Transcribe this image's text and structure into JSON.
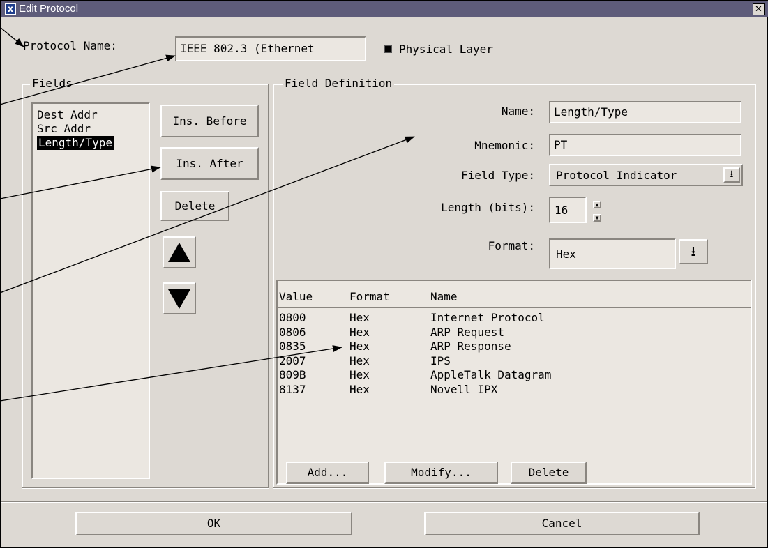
{
  "window": {
    "title": "Edit Protocol",
    "app_icon": "x-icon",
    "close_icon": "close-icon"
  },
  "protocol": {
    "name_label": "Protocol Name:",
    "name_value": "IEEE 802.3 (Ethernet",
    "physical_layer_label": "Physical Layer",
    "physical_layer_checked": true
  },
  "fields": {
    "group_label": "Fields",
    "items": [
      "Dest Addr",
      "Src  Addr",
      "Length/Type"
    ],
    "selected_index": 2,
    "buttons": {
      "ins_before": "Ins. Before",
      "ins_after": "Ins. After",
      "delete": "Delete",
      "move_up_icon": "up-triangle-icon",
      "move_down_icon": "down-triangle-icon"
    }
  },
  "field_definition": {
    "group_label": "Field Definition",
    "name_label": "Name:",
    "name_value": "Length/Type",
    "mnemonic_label": "Mnemonic:",
    "mnemonic_value": "PT",
    "field_type_label": "Field Type:",
    "field_type_value": "Protocol Indicator",
    "length_label": "Length (bits):",
    "length_value": "16",
    "format_label": "Format:",
    "format_value": "Hex",
    "table": {
      "columns": [
        "Value",
        "Format",
        "Name"
      ],
      "rows": [
        [
          "0800",
          "Hex",
          "Internet Protocol"
        ],
        [
          "0806",
          "Hex",
          "ARP Request"
        ],
        [
          "0835",
          "Hex",
          "ARP Response"
        ],
        [
          "2007",
          "Hex",
          "IPS"
        ],
        [
          "809B",
          "Hex",
          "AppleTalk Datagram"
        ],
        [
          "8137",
          "Hex",
          "Novell IPX"
        ]
      ]
    },
    "buttons": {
      "add": "Add...",
      "modify": "Modify...",
      "delete": "Delete"
    }
  },
  "dialog_buttons": {
    "ok": "OK",
    "cancel": "Cancel"
  }
}
